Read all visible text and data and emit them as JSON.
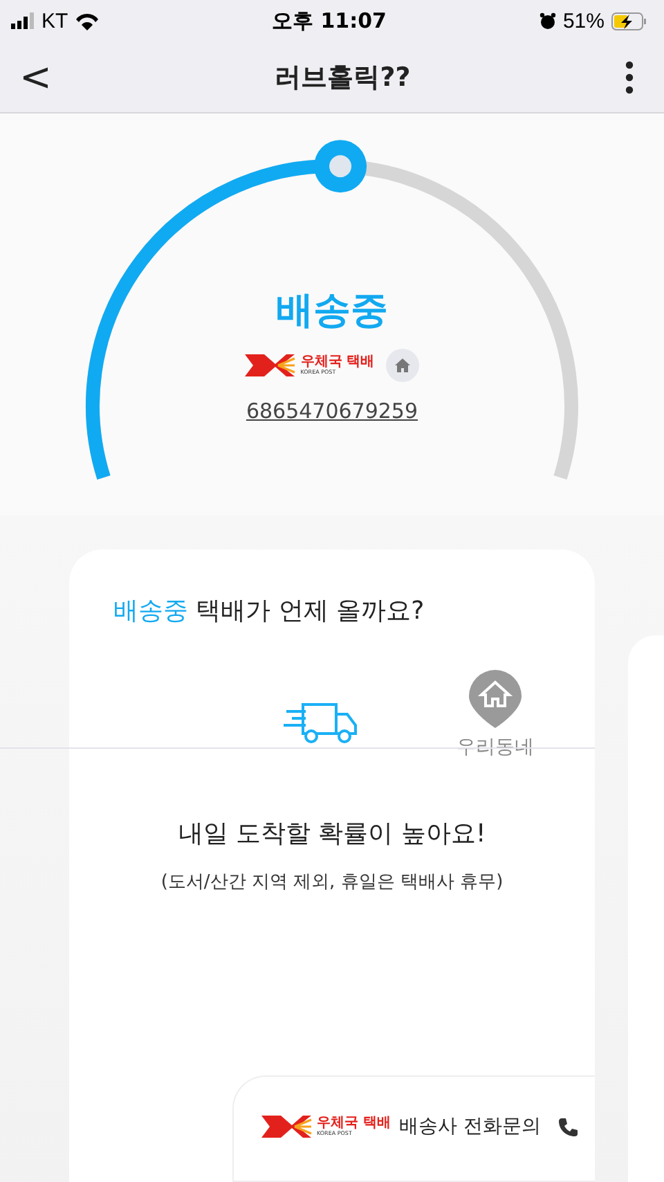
{
  "status_bar": {
    "carrier": "KT",
    "time": "오후 11:07",
    "battery": "51%",
    "charging": true
  },
  "nav": {
    "back": "<",
    "title": "러브홀릭??"
  },
  "tracking": {
    "status": "배송중",
    "courier_logo": {
      "name": "우체국 택배",
      "sub": "KOREA POST"
    },
    "number": "6865470679259"
  },
  "card": {
    "heading_status": "배송중",
    "heading_rest": " 택배가 언제 올까요?",
    "destination": "우리동네",
    "message": "내일 도착할 확률이 높아요!",
    "note": "(도서/산간 지역 제외, 휴일은 택배사 휴무)"
  },
  "contact": {
    "courier_logo": {
      "name": "우체국 택배",
      "sub": "KOREA POST"
    },
    "label": "배송사 전화문의"
  }
}
